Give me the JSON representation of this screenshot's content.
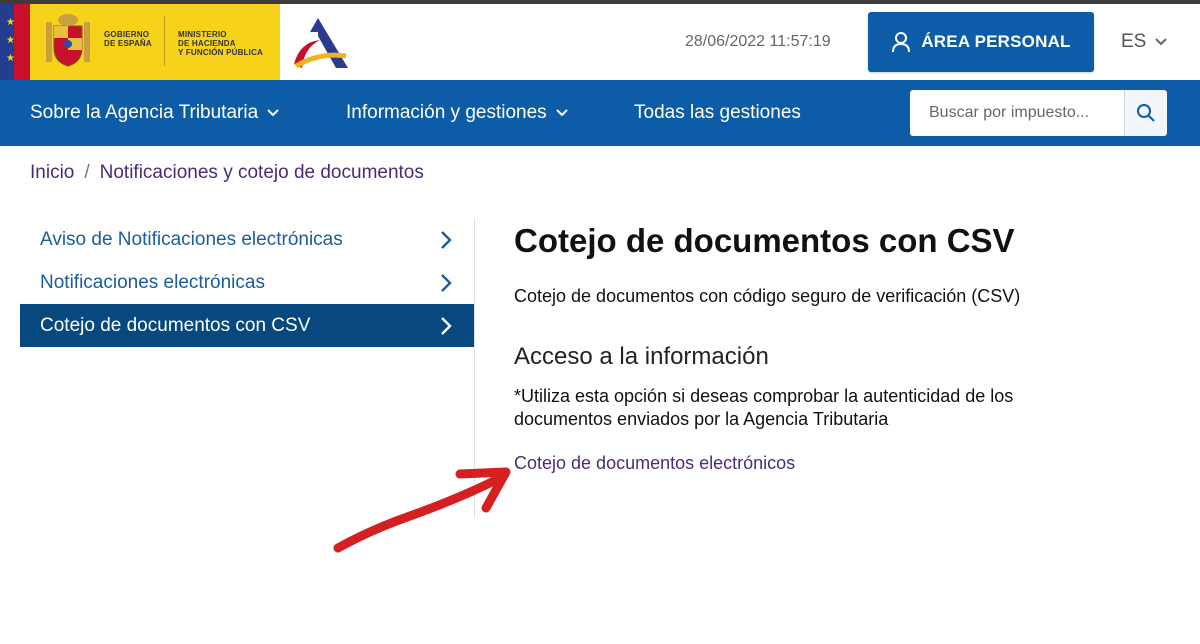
{
  "header": {
    "gov_line1": "GOBIERNO",
    "gov_line2": "DE ESPAÑA",
    "ministry_line1": "MINISTERIO",
    "ministry_line2": "DE HACIENDA",
    "ministry_line3": "Y FUNCIÓN PÚBLICA",
    "datetime": "28/06/2022 11:57:19",
    "area_personal_label": "ÁREA PERSONAL",
    "language": "ES"
  },
  "nav": {
    "items": [
      {
        "label": "Sobre la Agencia Tributaria",
        "has_dropdown": true
      },
      {
        "label": "Información y gestiones",
        "has_dropdown": true
      },
      {
        "label": "Todas las gestiones",
        "has_dropdown": false
      }
    ],
    "search_placeholder": "Buscar por impuesto..."
  },
  "breadcrumb": {
    "home": "Inicio",
    "separator": "/",
    "current": "Notificaciones y cotejo de documentos"
  },
  "sidebar": {
    "items": [
      {
        "label": "Aviso de Notificaciones electrónicas",
        "active": false
      },
      {
        "label": "Notificaciones electrónicas",
        "active": false
      },
      {
        "label": "Cotejo de documentos con CSV",
        "active": true
      }
    ]
  },
  "main": {
    "title": "Cotejo de documentos con CSV",
    "subtitle": "Cotejo de documentos con código seguro de verificación (CSV)",
    "section_title": "Acceso a la información",
    "note": "*Utiliza esta opción si deseas comprobar la autenticidad de los documentos enviados por la Agencia Tributaria",
    "link": "Cotejo de documentos electrónicos"
  },
  "colors": {
    "brand_blue": "#0d5ca8",
    "active_sidebar": "#07487f",
    "link_purple": "#4a2b7a",
    "gov_yellow": "#f6d21b",
    "annotation_red": "#d42020"
  }
}
